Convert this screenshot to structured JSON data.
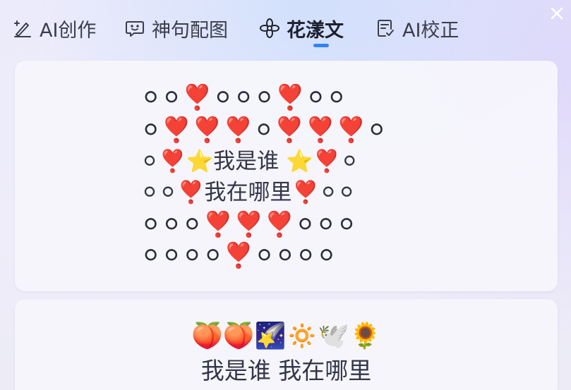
{
  "tabs": [
    {
      "label": "AI创作",
      "icon": "pen-sparkle-icon",
      "active": false
    },
    {
      "label": "神句配图",
      "icon": "chat-bubble-smile-icon",
      "active": false
    },
    {
      "label": "花漾文",
      "icon": "flower-icon",
      "active": true
    },
    {
      "label": "AI校正",
      "icon": "document-check-icon",
      "active": false
    }
  ],
  "close_icon": "close-icon",
  "accent_color": "#2f86f0",
  "results": [
    {
      "art_rows": [
        "⚪⚪❣️⚪⚪⚪❣️⚪⚪",
        "⚪❣️❣️❣️⚪❣️❣️❣️⚪",
        "⚪❣️⭐我是谁 ⭐❣️⚪",
        "⚪⚪❣️我在哪里❣️⚪⚪",
        "⚪⚪⚪❣️❣️❣️⚪⚪⚪",
        "⚪⚪⚪⚪❣️⚪⚪⚪⚪"
      ]
    },
    {
      "emoji_line": "🍑🍑🌠🔅🕊️🌻",
      "text_line": "我是谁 我在哪里"
    }
  ]
}
